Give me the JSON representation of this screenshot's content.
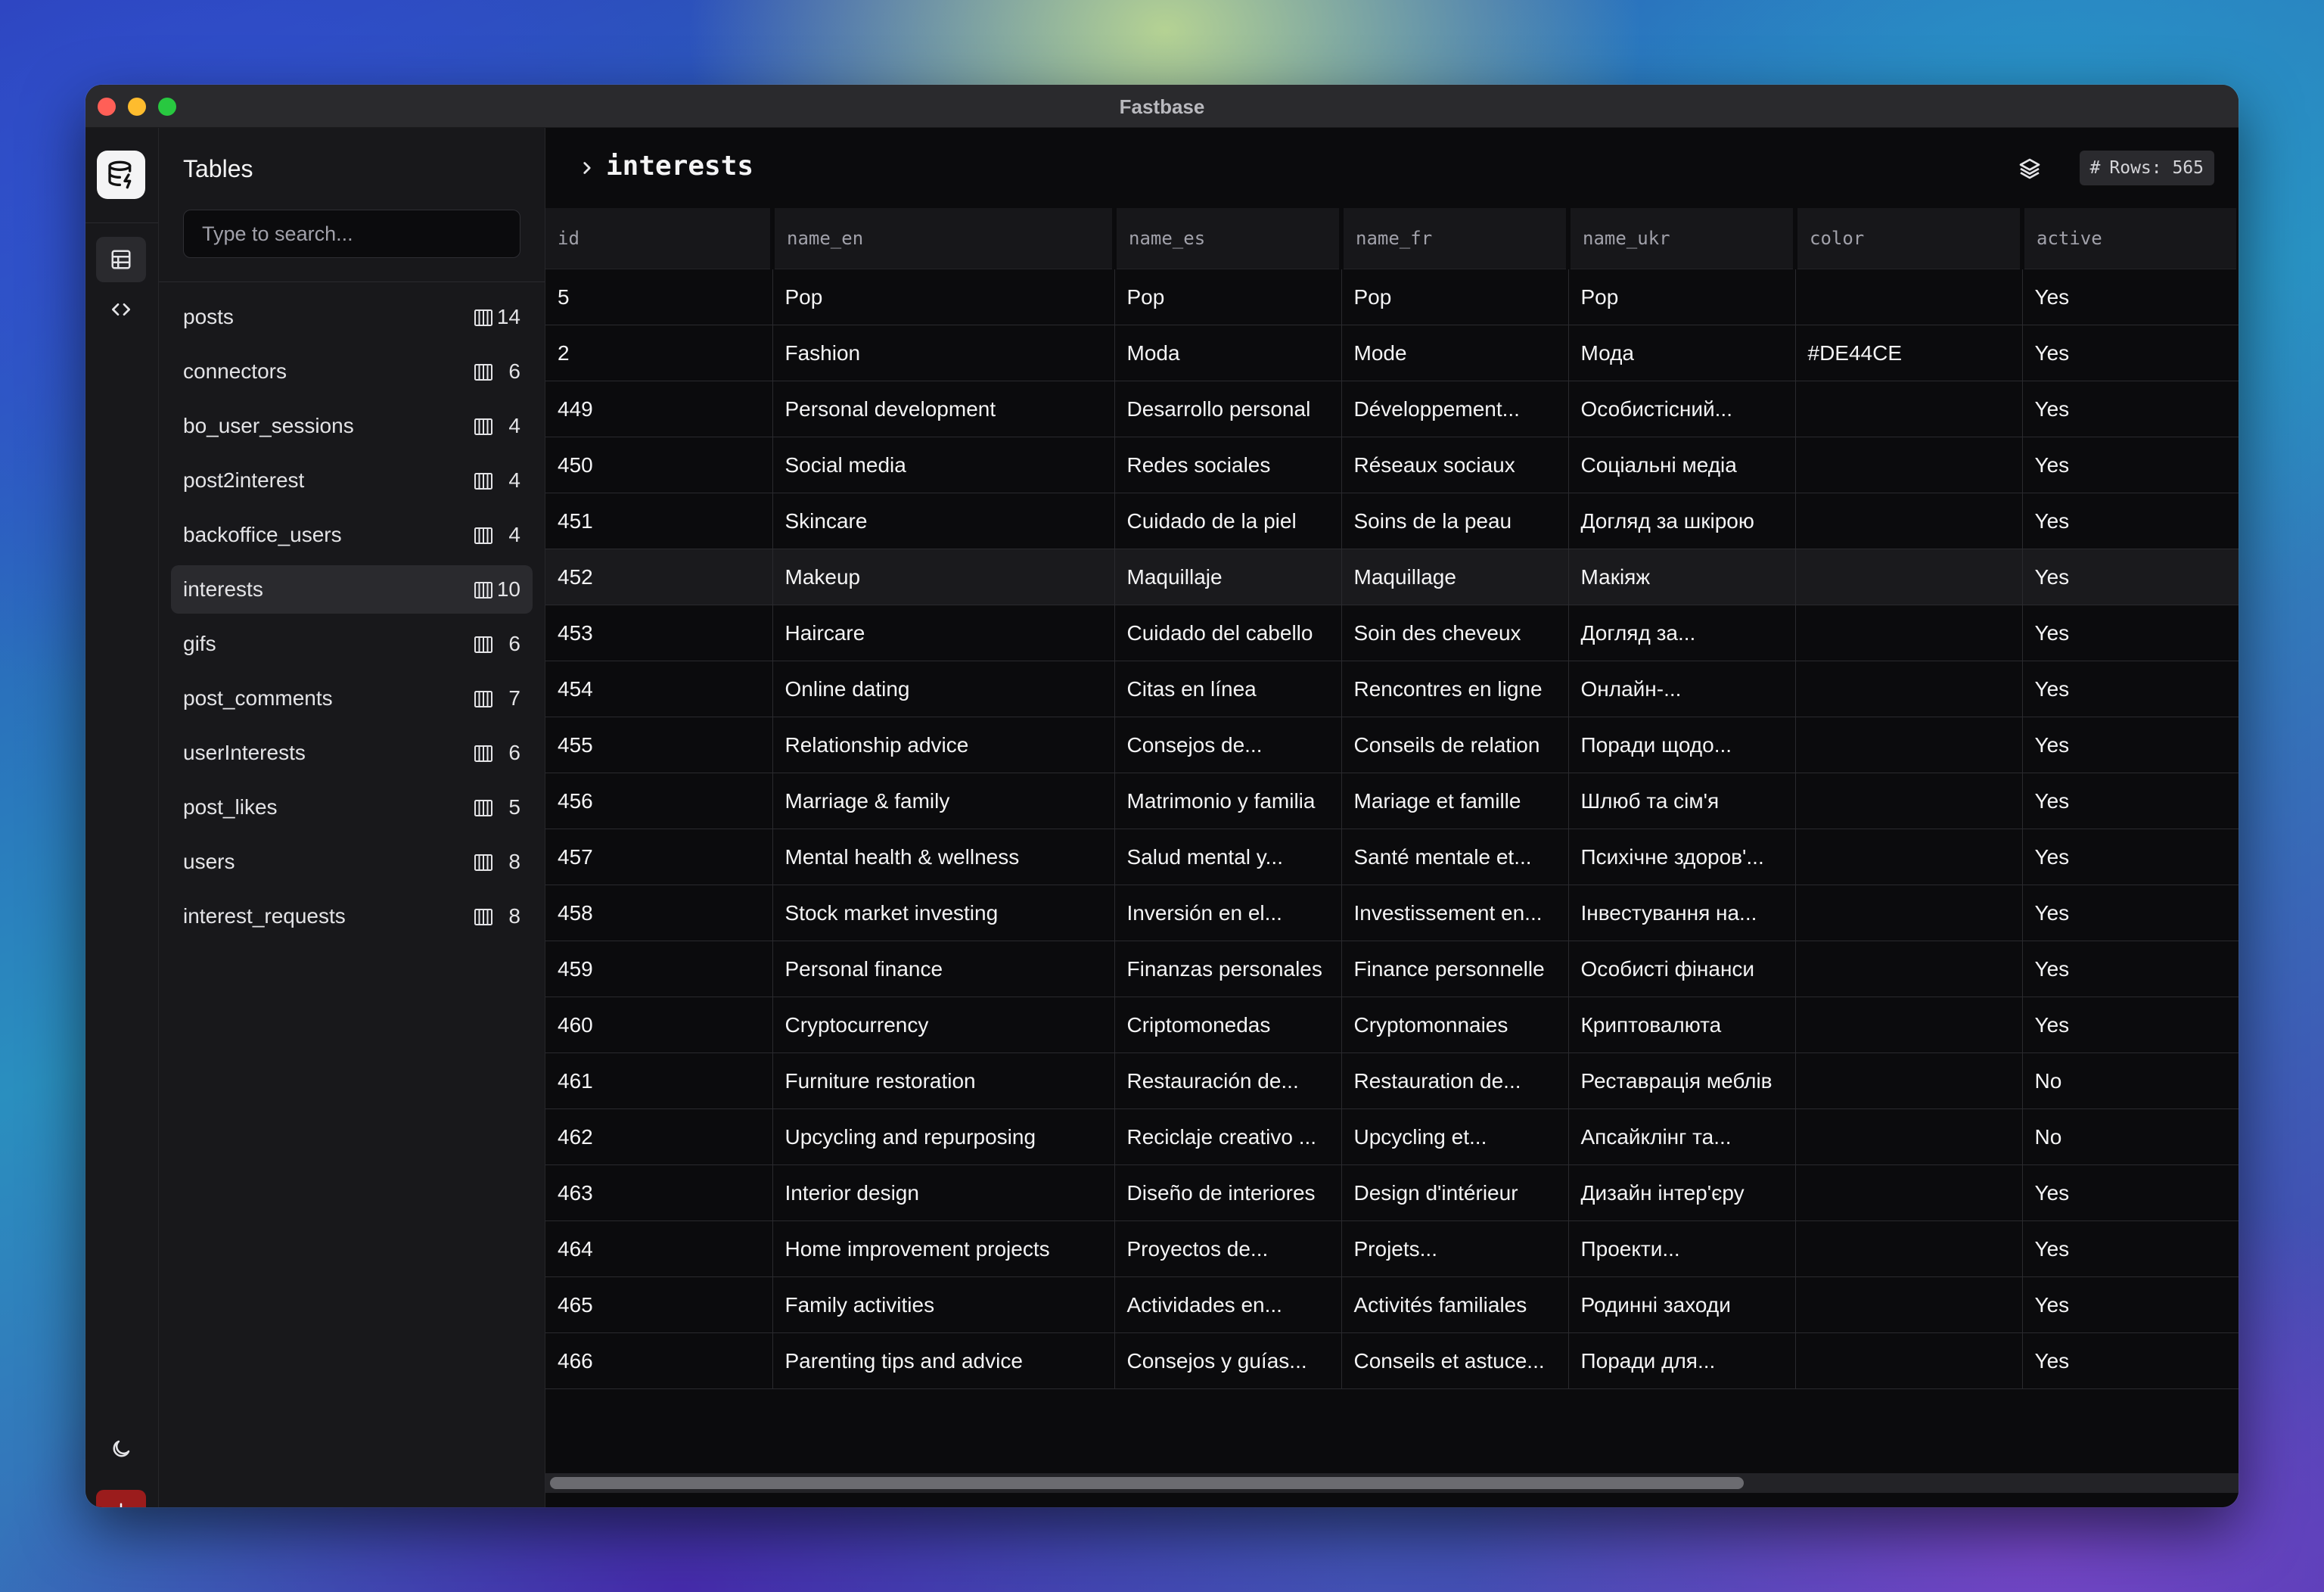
{
  "window": {
    "title": "Fastbase"
  },
  "sidebar": {
    "title": "Tables",
    "search_placeholder": "Type to search...",
    "tables": [
      {
        "name": "posts",
        "count": "14",
        "selected": false
      },
      {
        "name": "connectors",
        "count": "6",
        "selected": false
      },
      {
        "name": "bo_user_sessions",
        "count": "4",
        "selected": false
      },
      {
        "name": "post2interest",
        "count": "4",
        "selected": false
      },
      {
        "name": "backoffice_users",
        "count": "4",
        "selected": false
      },
      {
        "name": "interests",
        "count": "10",
        "selected": true
      },
      {
        "name": "gifs",
        "count": "6",
        "selected": false
      },
      {
        "name": "post_comments",
        "count": "7",
        "selected": false
      },
      {
        "name": "userInterests",
        "count": "6",
        "selected": false
      },
      {
        "name": "post_likes",
        "count": "5",
        "selected": false
      },
      {
        "name": "users",
        "count": "8",
        "selected": false
      },
      {
        "name": "interest_requests",
        "count": "8",
        "selected": false
      }
    ]
  },
  "main": {
    "title": "interests",
    "rows_badge": "Rows: 565",
    "columns": [
      "id",
      "name_en",
      "name_es",
      "name_fr",
      "name_ukr",
      "color",
      "active"
    ],
    "rows": [
      [
        "5",
        "Pop",
        "Pop",
        "Pop",
        "Pop",
        "",
        "Yes"
      ],
      [
        "2",
        "Fashion",
        "Moda",
        "Mode",
        "Мода",
        "#DE44CE",
        "Yes"
      ],
      [
        "449",
        "Personal development",
        "Desarrollo personal",
        "Développement...",
        "Особистісний...",
        "",
        "Yes"
      ],
      [
        "450",
        "Social media",
        "Redes sociales",
        "Réseaux sociaux",
        "Соціальні медіа",
        "",
        "Yes"
      ],
      [
        "451",
        "Skincare",
        "Cuidado de la piel",
        "Soins de la peau",
        "Догляд за шкірою",
        "",
        "Yes"
      ],
      [
        "452",
        "Makeup",
        "Maquillaje",
        "Maquillage",
        "Макіяж",
        "",
        "Yes"
      ],
      [
        "453",
        "Haircare",
        "Cuidado del cabello",
        "Soin des cheveux",
        "Догляд за...",
        "",
        "Yes"
      ],
      [
        "454",
        "Online dating",
        "Citas en línea",
        "Rencontres en ligne",
        "Онлайн-...",
        "",
        "Yes"
      ],
      [
        "455",
        "Relationship advice",
        "Consejos de...",
        "Conseils de relation",
        "Поради щодо...",
        "",
        "Yes"
      ],
      [
        "456",
        "Marriage & family",
        "Matrimonio y familia",
        "Mariage et famille",
        "Шлюб та сім'я",
        "",
        "Yes"
      ],
      [
        "457",
        "Mental health & wellness",
        "Salud mental y...",
        "Santé mentale et...",
        "Психічне здоров'...",
        "",
        "Yes"
      ],
      [
        "458",
        "Stock market investing",
        "Inversión en el...",
        "Investissement en...",
        "Інвестування на...",
        "",
        "Yes"
      ],
      [
        "459",
        "Personal finance",
        "Finanzas personales",
        "Finance personnelle",
        "Особисті фінанси",
        "",
        "Yes"
      ],
      [
        "460",
        "Cryptocurrency",
        "Criptomonedas",
        "Cryptomonnaies",
        "Криптовалюта",
        "",
        "Yes"
      ],
      [
        "461",
        "Furniture restoration",
        "Restauración de...",
        "Restauration de...",
        "Реставрація меблів",
        "",
        "No"
      ],
      [
        "462",
        "Upcycling and repurposing",
        "Reciclaje creativo ...",
        "Upcycling et...",
        "Апсайклінг та...",
        "",
        "No"
      ],
      [
        "463",
        "Interior design",
        "Diseño de interiores",
        "Design d'intérieur",
        "Дизайн інтер'єру",
        "",
        "Yes"
      ],
      [
        "464",
        "Home improvement projects",
        "Proyectos de...",
        "Projets...",
        "Проекти...",
        "",
        "Yes"
      ],
      [
        "465",
        "Family activities",
        "Actividades en...",
        "Activités familiales",
        "Родинні заходи",
        "",
        "Yes"
      ],
      [
        "466",
        "Parenting tips and advice",
        "Consejos y guías...",
        "Conseils et astuce...",
        "Поради для...",
        "",
        "Yes"
      ]
    ],
    "highlighted_row_index": 5
  },
  "icons": {
    "logo": "database-icon",
    "rail": [
      "table-icon",
      "code-icon",
      "moon-icon",
      "power-icon"
    ],
    "header": [
      "chevron-right-icon",
      "layers-icon",
      "hash-icon"
    ],
    "table_item": "columns-icon"
  },
  "colors": {
    "power_button": "#9b1c1c",
    "window_bg": "#0c0c0e",
    "sidebar_bg": "#18181b"
  }
}
